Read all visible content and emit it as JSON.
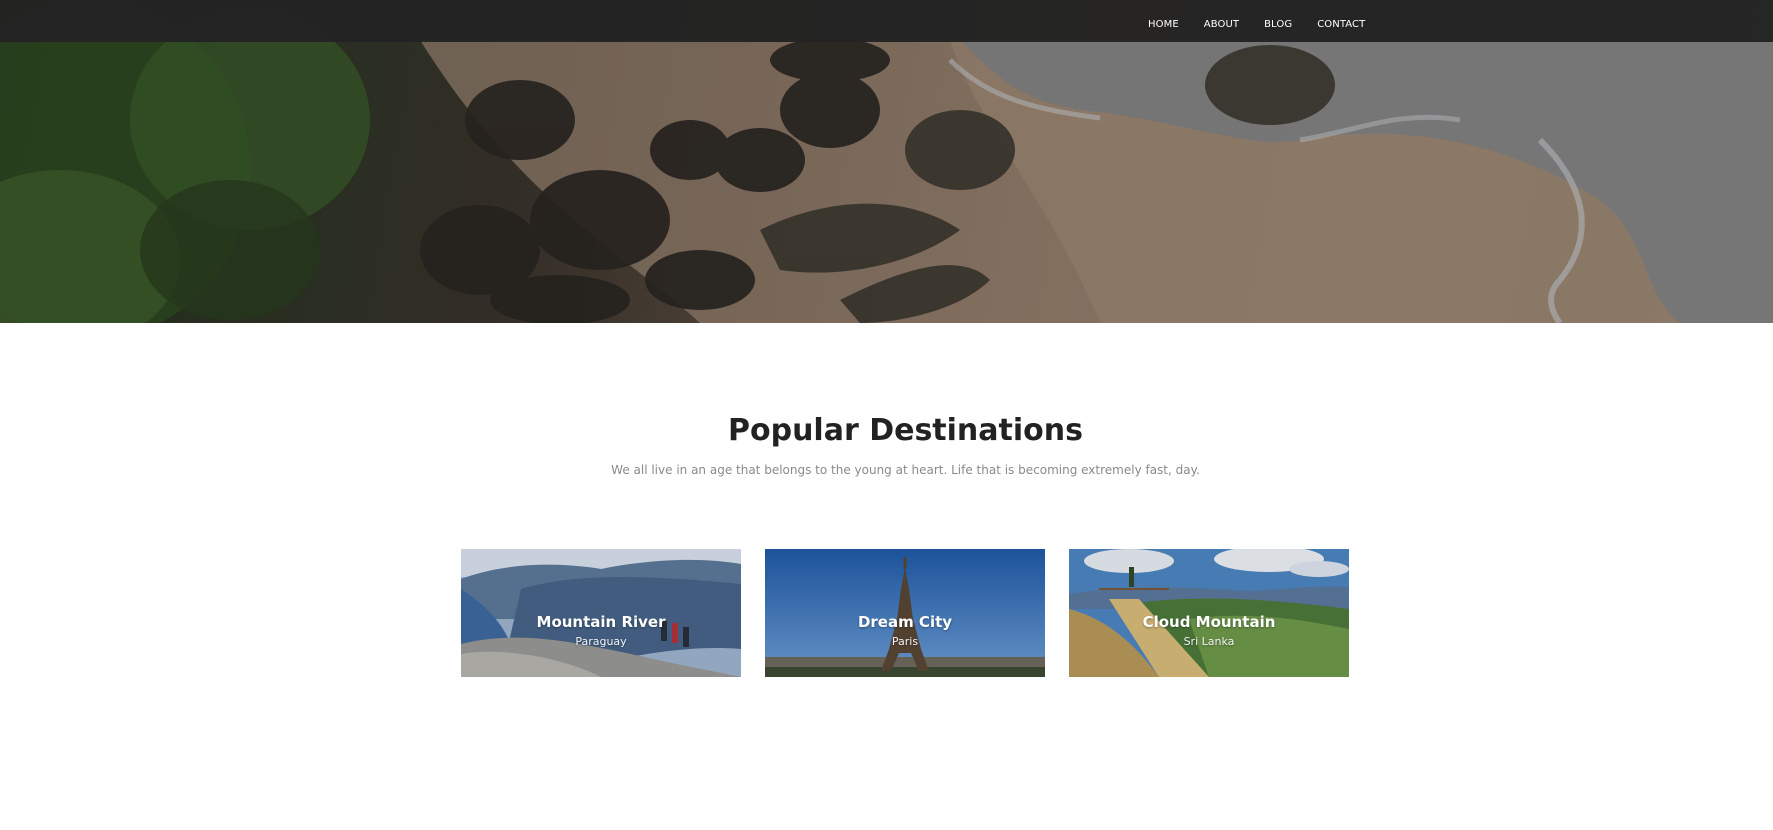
{
  "nav": {
    "items": [
      {
        "label": "HOME"
      },
      {
        "label": "ABOUT"
      },
      {
        "label": "BLOG"
      },
      {
        "label": "CONTACT"
      }
    ]
  },
  "destinations": {
    "title": "Popular Destinations",
    "subtitle": "We all live in an age that belongs to the young at heart. Life that is becoming extremely fast, day.",
    "cards": [
      {
        "name": "Mountain River",
        "location": "Paraguay"
      },
      {
        "name": "Dream City",
        "location": "Paris"
      },
      {
        "name": "Cloud Mountain",
        "location": "Sri Lanka"
      }
    ]
  },
  "colors": {
    "nav_background": "#232323",
    "title": "#222222",
    "subtitle": "#8a8a8a"
  }
}
